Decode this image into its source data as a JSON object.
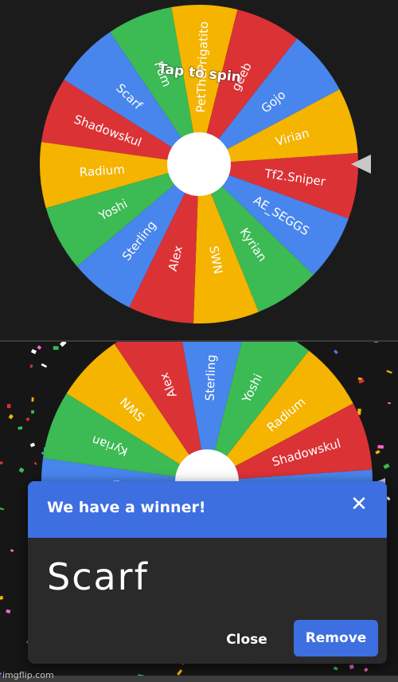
{
  "wheel": {
    "hint": "Tap to spin",
    "entries": [
      "PetThePrigatito",
      "geeb",
      "Gojo",
      "Virian",
      "Tf2.Sniper",
      "AE_SEGGS",
      "Kyrian",
      "SWN",
      "Alex",
      "Sterling",
      "Yoshi",
      "Radium",
      "Shadowskul",
      "Scarf",
      "Pum"
    ],
    "colors": [
      "#f4b400",
      "#db3236",
      "#4885ed",
      "#f4b400",
      "#db3236",
      "#4885ed",
      "#3cba54",
      "#f4b400",
      "#db3236",
      "#4885ed",
      "#3cba54",
      "#f4b400",
      "#db3236",
      "#4885ed",
      "#3cba54"
    ]
  },
  "dialog": {
    "title": "We have a winner!",
    "winner": "Scarf",
    "close_label": "Close",
    "remove_label": "Remove",
    "close_icon": "close-icon"
  },
  "watermark": "imgflip.com",
  "colors": {
    "accent": "#3d6fe0",
    "background": "#1b1b1b",
    "dialog": "#2a2a2a"
  }
}
